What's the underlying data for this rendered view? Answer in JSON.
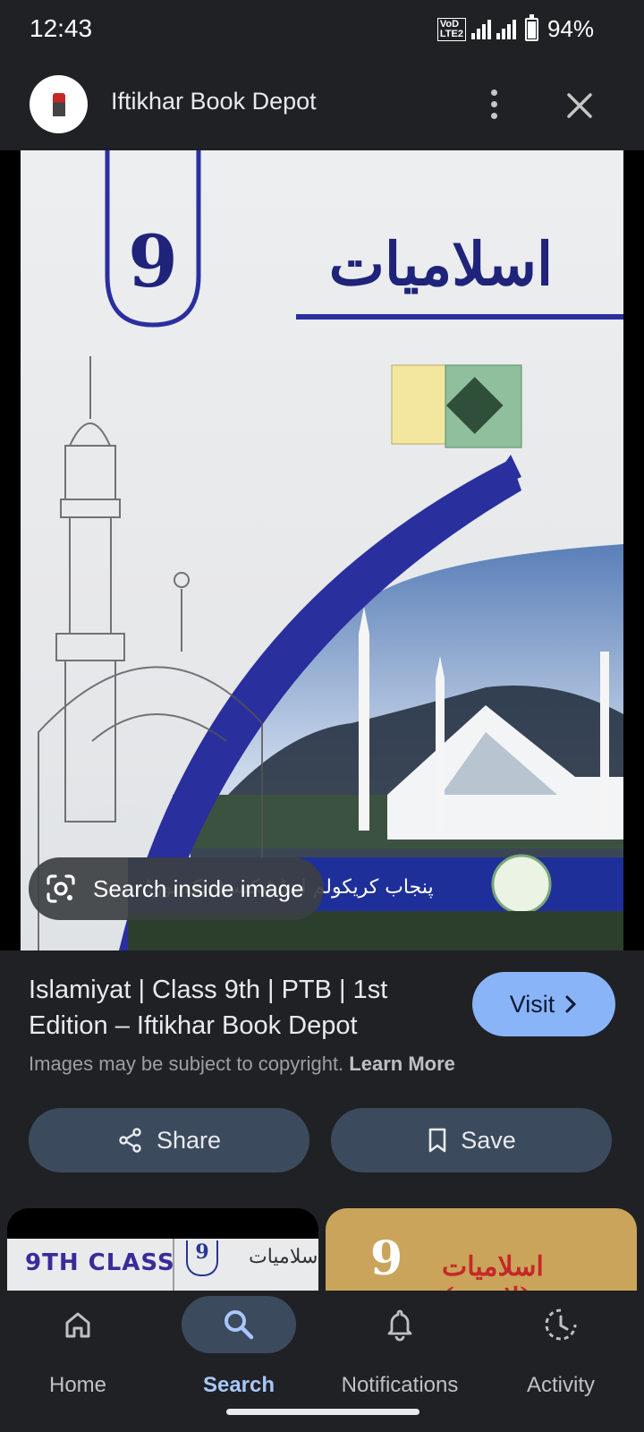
{
  "status_bar": {
    "time": "12:43",
    "network_badge": "Vo LTE2",
    "network_type": "4G",
    "battery": "94%"
  },
  "header": {
    "site_name": "Iftikhar Book Depot",
    "more_icon": "more-vert-icon",
    "close_icon": "close-icon"
  },
  "image": {
    "cover_number": "9",
    "cover_title_urdu": "اسلامیات",
    "cover_footer_urdu": "پنجاب کریکولم اینڈ ٹیکسٹ بک بورڈ",
    "lens_label": "Search inside image",
    "lens_icon": "google-lens-icon"
  },
  "result": {
    "title": "Islamiyat | Class 9th | PTB | 1st Edition – Iftikhar Book Depot",
    "visit_label": "Visit",
    "copyright_text": "Images may be subject to copyright.",
    "learn_more": "Learn More"
  },
  "actions": {
    "share_label": "Share",
    "save_label": "Save"
  },
  "thumbnails": {
    "left_label": "9TH CLASS",
    "left_number": "9",
    "left_urdu": "اسلامیات",
    "right_number": "9",
    "right_urdu": "اسلامیات (لازمی)"
  },
  "nav": {
    "items": [
      {
        "label": "Home",
        "icon": "home-icon"
      },
      {
        "label": "Search",
        "icon": "search-icon"
      },
      {
        "label": "Notifications",
        "icon": "bell-icon"
      },
      {
        "label": "Activity",
        "icon": "activity-icon"
      }
    ],
    "active": "Search"
  },
  "colors": {
    "background": "#202124",
    "accent": "#8ab4f8",
    "active_nav": "#a8c7fa",
    "button_bg": "#3c4a5e",
    "cover_blue": "#2a2f9e"
  }
}
